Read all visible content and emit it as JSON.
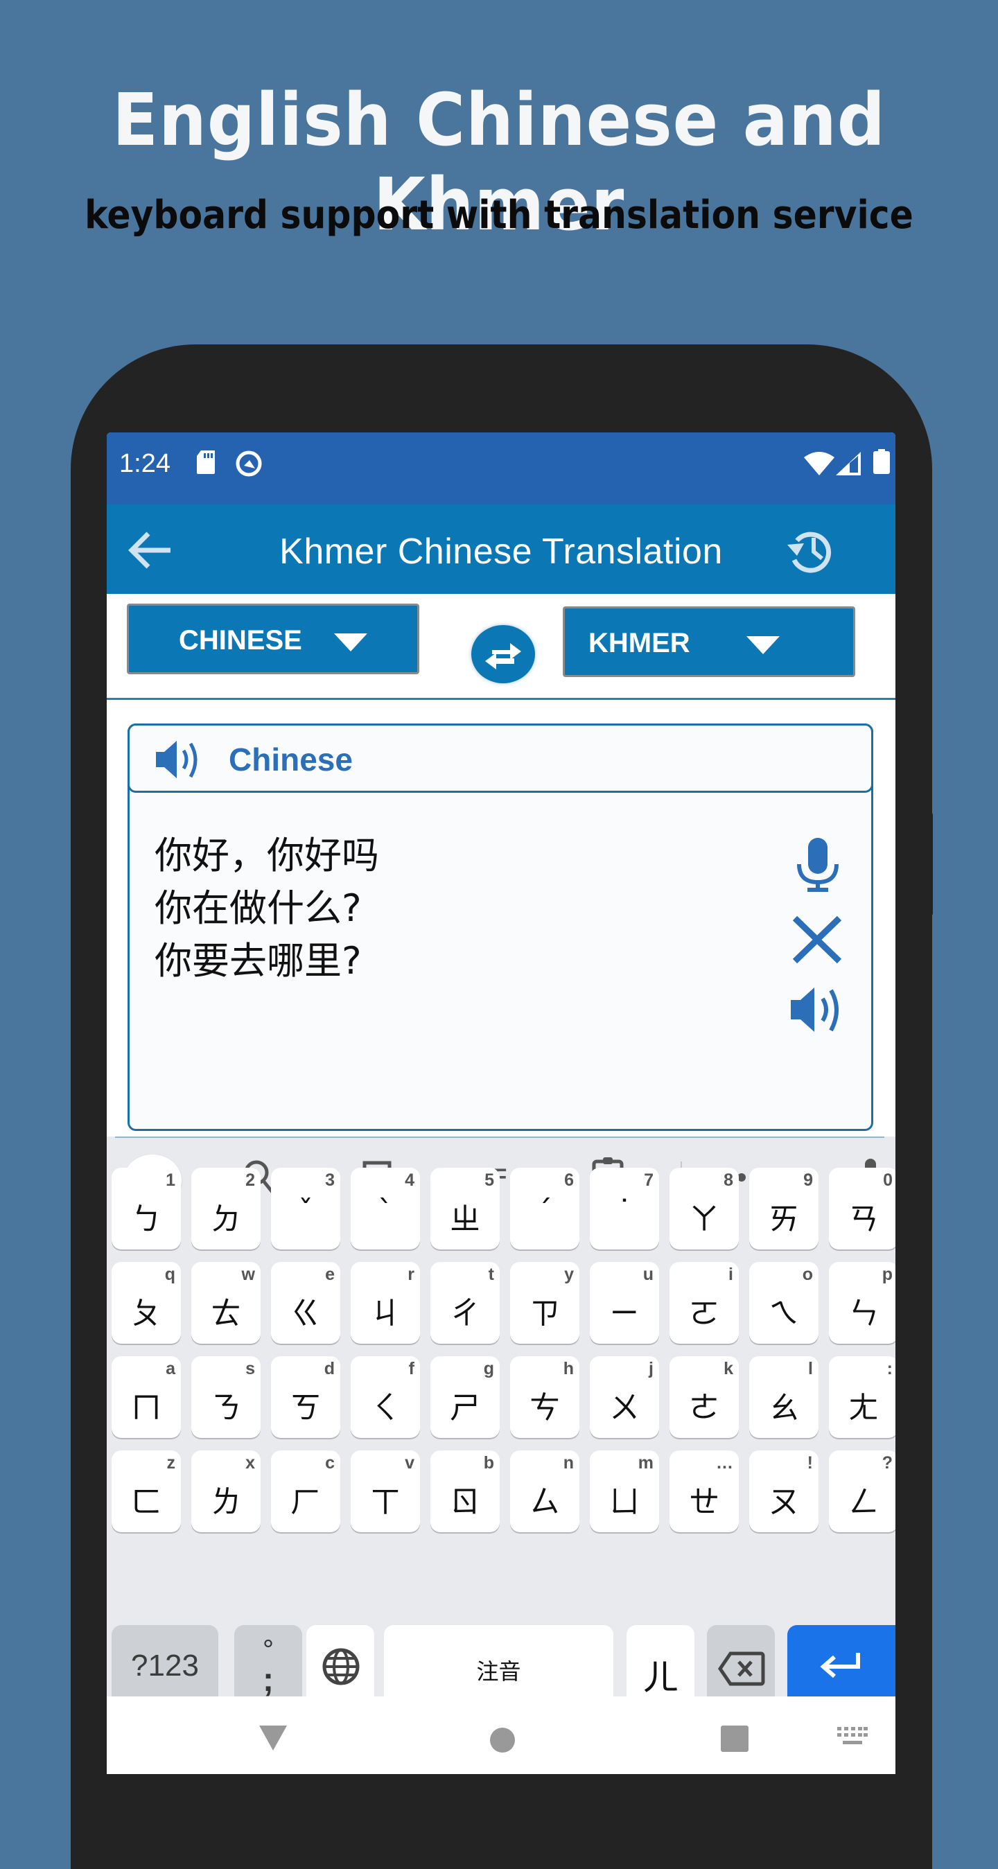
{
  "promo": {
    "title": "English Chinese and Khmer",
    "subtitle": "keyboard support with translation service"
  },
  "status_bar": {
    "time": "1:24",
    "left_icons": [
      "sd-card-icon",
      "data-saver-icon"
    ],
    "right_icons": [
      "wifi-icon",
      "signal-icon",
      "battery-icon"
    ]
  },
  "app_bar": {
    "title": "Khmer Chinese Translation",
    "back_icon": "arrow-left-icon",
    "history_icon": "history-icon"
  },
  "languages": {
    "source": "CHINESE",
    "target": "KHMER",
    "swap_icon": "swap-arrows-icon"
  },
  "input_card": {
    "language_label": "Chinese",
    "text": "你好，你好吗\n你在做什么?\n你要去哪里?",
    "actions": [
      "microphone-icon",
      "clear-icon",
      "speaker-icon"
    ]
  },
  "colors": {
    "background": "#4a769d",
    "status_bar": "#2563b0",
    "app_bar": "#0b78b5",
    "accent": "#2a6fb8",
    "enter_key": "#1a73e8"
  },
  "keyboard": {
    "toolbar": [
      "back-chevron-icon",
      "search-icon",
      "sticker-icon",
      "GIF",
      "clipboard-icon",
      "more-icon",
      "microphone-icon"
    ],
    "gif_label": "GIF",
    "rows": [
      [
        {
          "k": "ㄅ",
          "h": "1"
        },
        {
          "k": "ㄉ",
          "h": "2"
        },
        {
          "k": "ˇ",
          "h": "3"
        },
        {
          "k": "ˋ",
          "h": "4"
        },
        {
          "k": "ㄓ",
          "h": "5"
        },
        {
          "k": "ˊ",
          "h": "6"
        },
        {
          "k": "˙",
          "h": "7"
        },
        {
          "k": "ㄚ",
          "h": "8"
        },
        {
          "k": "ㄞ",
          "h": "9"
        },
        {
          "k": "ㄢ",
          "h": "0"
        }
      ],
      [
        {
          "k": "ㄆ",
          "h": "q"
        },
        {
          "k": "ㄊ",
          "h": "w"
        },
        {
          "k": "ㄍ",
          "h": "e"
        },
        {
          "k": "ㄐ",
          "h": "r"
        },
        {
          "k": "ㄔ",
          "h": "t"
        },
        {
          "k": "ㄗ",
          "h": "y"
        },
        {
          "k": "ㄧ",
          "h": "u"
        },
        {
          "k": "ㄛ",
          "h": "i"
        },
        {
          "k": "ㄟ",
          "h": "o"
        },
        {
          "k": "ㄣ",
          "h": "p"
        }
      ],
      [
        {
          "k": "ㄇ",
          "h": "a"
        },
        {
          "k": "ㄋ",
          "h": "s"
        },
        {
          "k": "ㄎ",
          "h": "d"
        },
        {
          "k": "ㄑ",
          "h": "f"
        },
        {
          "k": "ㄕ",
          "h": "g"
        },
        {
          "k": "ㄘ",
          "h": "h"
        },
        {
          "k": "ㄨ",
          "h": "j"
        },
        {
          "k": "ㄜ",
          "h": "k"
        },
        {
          "k": "ㄠ",
          "h": "l"
        },
        {
          "k": "ㄤ",
          "h": ":"
        }
      ],
      [
        {
          "k": "ㄈ",
          "h": "z"
        },
        {
          "k": "ㄌ",
          "h": "x"
        },
        {
          "k": "ㄏ",
          "h": "c"
        },
        {
          "k": "ㄒ",
          "h": "v"
        },
        {
          "k": "ㄖ",
          "h": "b"
        },
        {
          "k": "ㄙ",
          "h": "n"
        },
        {
          "k": "ㄩ",
          "h": "m"
        },
        {
          "k": "ㄝ",
          "h": "…"
        },
        {
          "k": "ㄡ",
          "h": "!"
        },
        {
          "k": "ㄥ",
          "h": "?"
        }
      ]
    ],
    "bottom_row": {
      "symbols": "?123",
      "punct_top": "°",
      "punct_bottom": ";",
      "space": "注音",
      "er": "ㄦ"
    }
  },
  "nav_bar": [
    "back-triangle-icon",
    "home-circle-icon",
    "recents-square-icon",
    "keyboard-hide-icon"
  ]
}
